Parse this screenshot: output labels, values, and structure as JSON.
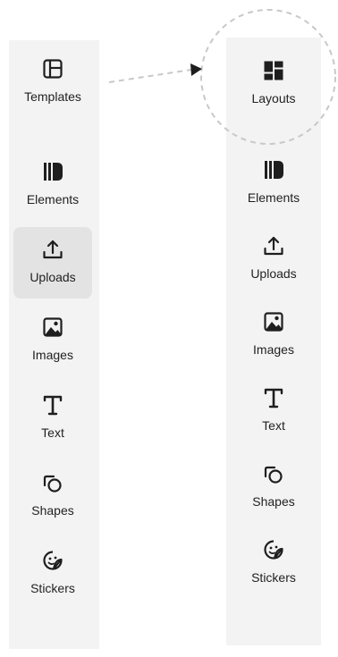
{
  "left_sidebar": {
    "items": [
      {
        "label": "Templates",
        "icon": "templates-icon"
      },
      {
        "label": "Elements",
        "icon": "elements-icon"
      },
      {
        "label": "Uploads",
        "icon": "upload-icon",
        "active": true
      },
      {
        "label": "Images",
        "icon": "image-icon"
      },
      {
        "label": "Text",
        "icon": "text-icon"
      },
      {
        "label": "Shapes",
        "icon": "shapes-icon"
      },
      {
        "label": "Stickers",
        "icon": "sticker-icon"
      }
    ]
  },
  "right_sidebar": {
    "items": [
      {
        "label": "Layouts",
        "icon": "layouts-icon",
        "highlighted": true
      },
      {
        "label": "Elements",
        "icon": "elements-icon"
      },
      {
        "label": "Uploads",
        "icon": "upload-icon"
      },
      {
        "label": "Images",
        "icon": "image-icon"
      },
      {
        "label": "Text",
        "icon": "text-icon"
      },
      {
        "label": "Shapes",
        "icon": "shapes-icon"
      },
      {
        "label": "Stickers",
        "icon": "sticker-icon"
      }
    ]
  },
  "colors": {
    "sidebar_bg": "#f3f3f3",
    "active_bg": "#e3e3e3",
    "icon": "#1e1e1e",
    "callout_stroke": "#c8c8c8"
  }
}
